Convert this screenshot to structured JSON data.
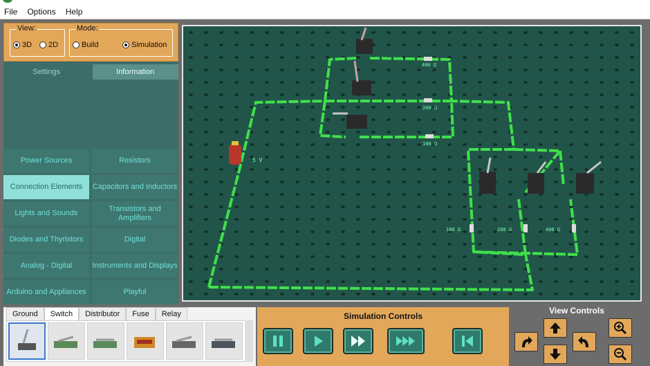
{
  "menu": {
    "file": "File",
    "options": "Options",
    "help": "Help"
  },
  "view": {
    "legend": "View:",
    "opt3d": "3D",
    "opt2d": "2D",
    "selected": "3D"
  },
  "mode": {
    "legend": "Mode:",
    "build": "Build",
    "simulation": "Simulation",
    "selected": "Simulation"
  },
  "panel_tabs": {
    "settings": "Settings",
    "information": "Information",
    "active": "Information"
  },
  "categories": [
    "Power Sources",
    "Resistors",
    "Connection Elements",
    "Capacitors and Inductors",
    "Lights and Sounds",
    "Transistors and Amplifiers",
    "Diodes and Thyristors",
    "Digital",
    "Analog - Digital",
    "Instruments and Displays",
    "Arduino and Appliances",
    "Playful"
  ],
  "active_category": "Connection Elements",
  "palette_tabs": [
    "Ground",
    "Switch",
    "Distributor",
    "Fuse",
    "Relay"
  ],
  "palette_active": "Switch",
  "circuit": {
    "source_label": "5 V",
    "resistors": [
      "400 Ω",
      "200 Ω",
      "100 Ω",
      "100 Ω",
      "200 Ω",
      "400 Ω"
    ]
  },
  "sim": {
    "title": "Simulation Controls"
  },
  "viewctl": {
    "title": "View Controls"
  },
  "colors": {
    "accent": "#e3a75a",
    "panel": "#3c6d68",
    "wire": "#3fe04a",
    "board": "#22554a"
  }
}
